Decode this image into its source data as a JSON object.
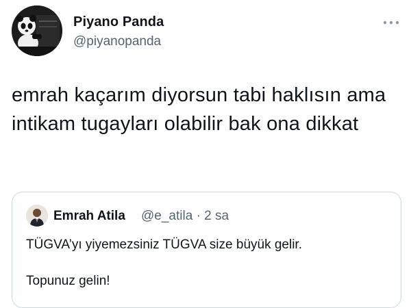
{
  "tweet": {
    "author": {
      "name": "Piyano Panda",
      "handle": "@piyanopanda",
      "avatar_icon": "panda-at-piano-avatar"
    },
    "more_icon": "more-dots-icon",
    "text": "emrah kaçarım diyorsun tabi haklısın ama intikam tugayları olabilir bak ona dikkat"
  },
  "quote": {
    "author": {
      "name": "Emrah Atila",
      "handle": "@e_atila",
      "separator": "·",
      "time": "2 sa",
      "avatar_icon": "user-photo-avatar"
    },
    "text_line1": "TÜGVA’yı yiyemezsiniz TÜGVA size büyük gelir.",
    "text_line2": "Topunuz gelin!"
  },
  "colors": {
    "text": "#0f1419",
    "secondary": "#536471",
    "border": "#cfd9de"
  }
}
